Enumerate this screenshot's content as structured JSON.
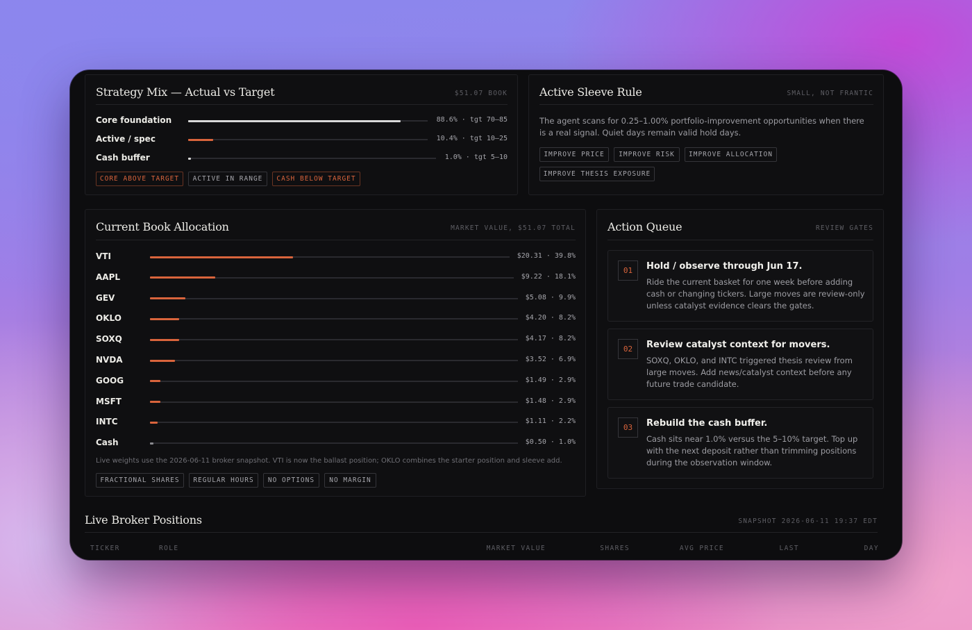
{
  "strategy_mix": {
    "title": "Strategy Mix — Actual vs Target",
    "meta": "$51.07 BOOK",
    "rows": [
      {
        "label": "Core foundation",
        "value_text": "88.6% · tgt 70–85",
        "actual_pct": 88.6
      },
      {
        "label": "Active / spec",
        "value_text": "10.4% · tgt 10–25",
        "actual_pct": 10.4
      },
      {
        "label": "Cash buffer",
        "value_text": "1.0% · tgt 5–10",
        "actual_pct": 1.0
      }
    ],
    "chips": [
      "CORE ABOVE TARGET",
      "ACTIVE IN RANGE",
      "CASH BELOW TARGET"
    ]
  },
  "sleeve_rule": {
    "title": "Active Sleeve Rule",
    "meta": "SMALL, NOT FRANTIC",
    "description": "The agent scans for 0.25–1.00% portfolio-improvement opportunities when there is a real signal. Quiet days remain valid hold days.",
    "chips": [
      "IMPROVE PRICE",
      "IMPROVE RISK",
      "IMPROVE ALLOCATION",
      "IMPROVE THESIS EXPOSURE"
    ]
  },
  "allocation": {
    "title": "Current Book Allocation",
    "meta": "MARKET VALUE, $51.07 TOTAL",
    "rows": [
      {
        "ticker": "VTI",
        "value_text": "$20.31 · 39.8%",
        "pct": 39.8
      },
      {
        "ticker": "AAPL",
        "value_text": "$9.22 · 18.1%",
        "pct": 18.1
      },
      {
        "ticker": "GEV",
        "value_text": "$5.08 · 9.9%",
        "pct": 9.9
      },
      {
        "ticker": "OKLO",
        "value_text": "$4.20 · 8.2%",
        "pct": 8.2
      },
      {
        "ticker": "SOXQ",
        "value_text": "$4.17 · 8.2%",
        "pct": 8.2
      },
      {
        "ticker": "NVDA",
        "value_text": "$3.52 · 6.9%",
        "pct": 6.9
      },
      {
        "ticker": "GOOG",
        "value_text": "$1.49 · 2.9%",
        "pct": 2.9
      },
      {
        "ticker": "MSFT",
        "value_text": "$1.48 · 2.9%",
        "pct": 2.9
      },
      {
        "ticker": "INTC",
        "value_text": "$1.11 · 2.2%",
        "pct": 2.2
      },
      {
        "ticker": "Cash",
        "value_text": "$0.50 · 1.0%",
        "pct": 1.0
      }
    ],
    "note": "Live weights use the 2026-06-11 broker snapshot. VTI is now the ballast position; OKLO combines the starter position and sleeve add.",
    "chips": [
      "FRACTIONAL SHARES",
      "REGULAR HOURS",
      "NO OPTIONS",
      "NO MARGIN"
    ]
  },
  "action_queue": {
    "title": "Action Queue",
    "meta": "REVIEW GATES",
    "items": [
      {
        "num": "01",
        "title": "Hold / observe through Jun 17.",
        "description": "Ride the current basket for one week before adding cash or changing tickers. Large moves are review-only unless catalyst evidence clears the gates."
      },
      {
        "num": "02",
        "title": "Review catalyst context for movers.",
        "description": "SOXQ, OKLO, and INTC triggered thesis review from large moves. Add news/catalyst context before any future trade candidate."
      },
      {
        "num": "03",
        "title": "Rebuild the cash buffer.",
        "description": "Cash sits near 1.0% versus the 5–10% target. Top up with the next deposit rather than trimming positions during the observation window."
      }
    ]
  },
  "positions": {
    "title": "Live Broker Positions",
    "meta": "SNAPSHOT 2026-06-11 19:37 EDT",
    "columns": [
      "TICKER",
      "ROLE",
      "MARKET VALUE",
      "SHARES",
      "AVG PRICE",
      "LAST",
      "DAY"
    ]
  },
  "colors": {
    "accent": "#d9643c",
    "core_bar": "#d8d8d8",
    "panel_bg": "#0f0f11"
  }
}
